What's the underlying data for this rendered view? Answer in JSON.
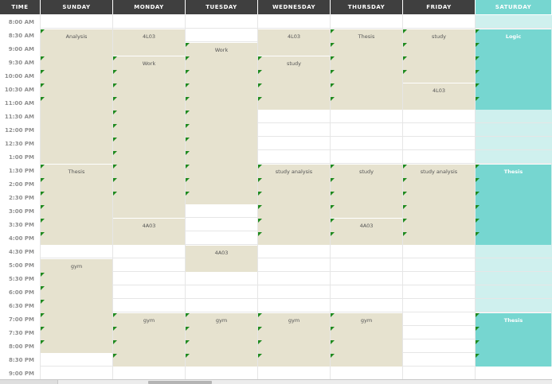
{
  "header": {
    "time_label": "TIME",
    "days": [
      "SUNDAY",
      "MONDAY",
      "TUESDAY",
      "WEDNESDAY",
      "THURSDAY",
      "FRIDAY",
      "SATURDAY"
    ]
  },
  "times": [
    "8:00 AM",
    "8:30 AM",
    "9:00 AM",
    "9:30 AM",
    "10:00 AM",
    "10:30 AM",
    "11:00 AM",
    "11:30 AM",
    "12:00 PM",
    "12:30 PM",
    "1:00 PM",
    "1:30 PM",
    "2:00 PM",
    "2:30 PM",
    "3:00 PM",
    "3:30 PM",
    "4:00 PM",
    "4:30 PM",
    "5:00 PM",
    "5:30 PM",
    "6:00 PM",
    "6:30 PM",
    "7:00 PM",
    "7:30 PM",
    "8:00 PM",
    "8:30 PM",
    "9:00 PM"
  ],
  "events": [
    {
      "day": 0,
      "start": 1,
      "end": 11,
      "label": "Analysis",
      "ticks": [
        1,
        3,
        4,
        5,
        6
      ]
    },
    {
      "day": 0,
      "start": 11,
      "end": 17,
      "label": "Thesis",
      "ticks": [
        11,
        12,
        13,
        14,
        15,
        16
      ]
    },
    {
      "day": 0,
      "start": 18,
      "end": 25,
      "label": "gym",
      "ticks": [
        19,
        20,
        21,
        22,
        23,
        24
      ]
    },
    {
      "day": 1,
      "start": 1,
      "end": 3,
      "label": "4L03",
      "ticks": []
    },
    {
      "day": 1,
      "start": 3,
      "end": 15,
      "label": "Work",
      "ticks": [
        3,
        4,
        5,
        6,
        7,
        8,
        9,
        10,
        11,
        12,
        13
      ]
    },
    {
      "day": 1,
      "start": 15,
      "end": 17,
      "label": "4A03",
      "ticks": []
    },
    {
      "day": 1,
      "start": 22,
      "end": 26,
      "label": "gym",
      "ticks": [
        22,
        23,
        24,
        25
      ]
    },
    {
      "day": 2,
      "start": 2,
      "end": 14,
      "label": "Work",
      "ticks": [
        2,
        3,
        4,
        5,
        6,
        7,
        8,
        9,
        10,
        11,
        12,
        13
      ]
    },
    {
      "day": 2,
      "start": 17,
      "end": 19,
      "label": "4A03",
      "ticks": []
    },
    {
      "day": 2,
      "start": 22,
      "end": 26,
      "label": "gym",
      "ticks": [
        22,
        23,
        24,
        25
      ]
    },
    {
      "day": 3,
      "start": 1,
      "end": 3,
      "label": "4L03",
      "ticks": []
    },
    {
      "day": 3,
      "start": 3,
      "end": 7,
      "label": "study",
      "ticks": [
        3,
        4,
        5,
        6
      ]
    },
    {
      "day": 3,
      "start": 11,
      "end": 17,
      "label": "study analysis",
      "ticks": [
        11,
        12,
        13,
        14,
        15,
        16
      ]
    },
    {
      "day": 3,
      "start": 22,
      "end": 26,
      "label": "gym",
      "ticks": [
        22,
        23,
        24,
        25
      ]
    },
    {
      "day": 4,
      "start": 1,
      "end": 7,
      "label": "Thesis",
      "ticks": [
        1,
        2,
        3,
        4,
        5,
        6
      ]
    },
    {
      "day": 4,
      "start": 11,
      "end": 15,
      "label": "study",
      "ticks": [
        11,
        12,
        13,
        14
      ]
    },
    {
      "day": 4,
      "start": 15,
      "end": 17,
      "label": "4A03",
      "ticks": [
        15,
        16
      ]
    },
    {
      "day": 4,
      "start": 22,
      "end": 26,
      "label": "gym",
      "ticks": [
        22,
        23,
        24,
        25
      ]
    },
    {
      "day": 5,
      "start": 1,
      "end": 5,
      "label": "study",
      "ticks": [
        1,
        2,
        3,
        4
      ]
    },
    {
      "day": 5,
      "start": 5,
      "end": 7,
      "label": "4L03",
      "ticks": []
    },
    {
      "day": 5,
      "start": 11,
      "end": 17,
      "label": "study analysis",
      "ticks": [
        11,
        12,
        13,
        14,
        15,
        16
      ]
    },
    {
      "day": 6,
      "start": 1,
      "end": 7,
      "label": "Logic",
      "sat": true,
      "ticks": [
        1,
        2,
        3,
        4,
        5,
        6
      ]
    },
    {
      "day": 6,
      "start": 11,
      "end": 17,
      "label": "Thesis",
      "sat": true,
      "ticks": [
        11,
        12,
        13,
        14,
        15,
        16
      ]
    },
    {
      "day": 6,
      "start": 22,
      "end": 26,
      "label": "Thesis",
      "sat": true,
      "ticks": [
        22,
        23,
        24,
        25
      ]
    }
  ],
  "colors": {
    "header_bg": "#3f3f3f",
    "saturday_accent": "#76d6d0",
    "event_bg": "#e6e2cf",
    "tick_green": "#1f8a1f"
  }
}
